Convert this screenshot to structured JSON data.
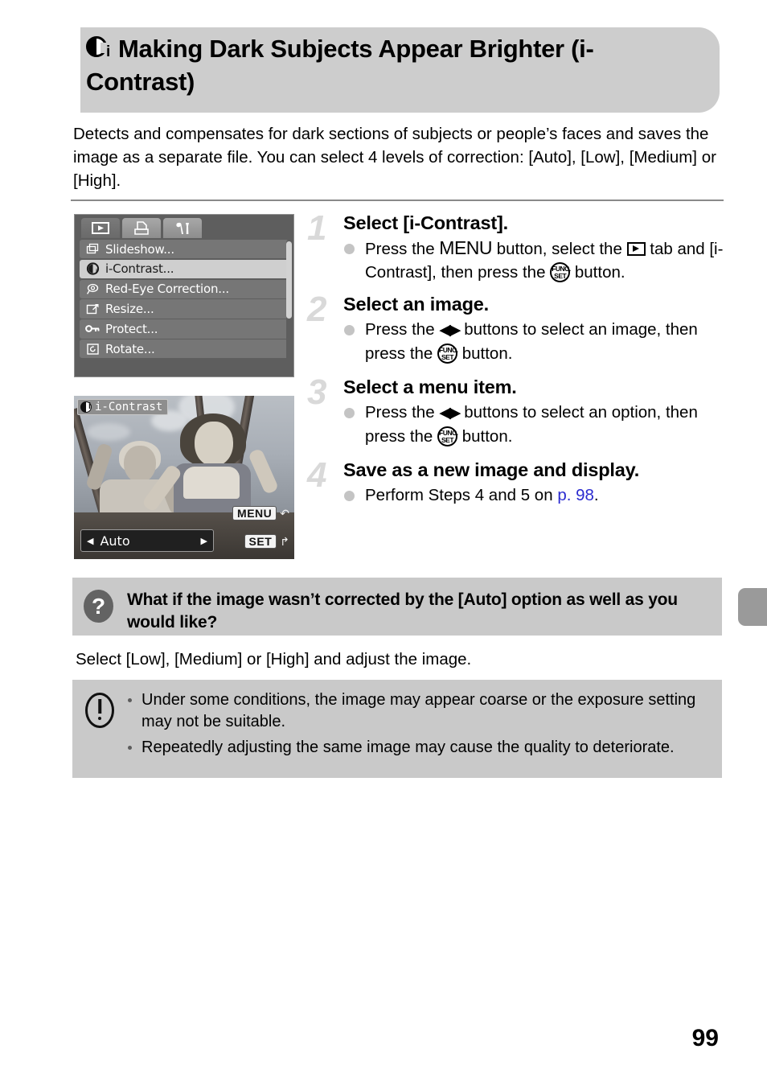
{
  "header": {
    "icon": "i-contrast-icon",
    "title": "Making Dark Subjects Appear Brighter (i-Contrast)",
    "band_color": "#cdcdcd"
  },
  "intro": {
    "text": "Detects and compensates for dark sections of subjects or people’s faces and saves the image as a separate file. You can select 4 levels of correction: [Auto], [Low], [Medium] or [High]."
  },
  "camera_menu_screen": {
    "tabs": [
      {
        "name": "playback-tab",
        "icon": "playback-icon",
        "active": true
      },
      {
        "name": "print-tab",
        "icon": "print-icon",
        "active": false
      },
      {
        "name": "settings-tab",
        "icon": "wrench-hammer-icon",
        "active": false
      }
    ],
    "items": [
      {
        "icon": "slideshow-icon",
        "label": "Slideshow...",
        "selected": false
      },
      {
        "icon": "i-contrast-icon",
        "label": "i-Contrast...",
        "selected": true
      },
      {
        "icon": "red-eye-icon",
        "label": "Red-Eye Correction...",
        "selected": false
      },
      {
        "icon": "resize-icon",
        "label": "Resize...",
        "selected": false
      },
      {
        "icon": "key-icon",
        "label": "Protect...",
        "selected": false
      },
      {
        "icon": "rotate-icon",
        "label": "Rotate...",
        "selected": false
      }
    ]
  },
  "camera_photo_screen": {
    "badge_icon": "i-contrast-icon",
    "badge_label": "i-Contrast",
    "option_value": "Auto",
    "left_arrow": "◀",
    "right_arrow": "▶",
    "hints": [
      {
        "key": "MENU",
        "glyph": "↶",
        "name": "menu-hint"
      },
      {
        "key": "SET",
        "glyph": "↱",
        "name": "set-hint"
      }
    ]
  },
  "steps": [
    {
      "number": "1",
      "title": "Select [i-Contrast].",
      "body_parts": [
        {
          "t": "text",
          "v": "Press the "
        },
        {
          "t": "menu",
          "v": "MENU"
        },
        {
          "t": "text",
          "v": " button, select the "
        },
        {
          "t": "icon",
          "v": "playback-icon"
        },
        {
          "t": "text",
          "v": " tab and [i-Contrast], then press the "
        },
        {
          "t": "icon",
          "v": "func-set-icon"
        },
        {
          "t": "text",
          "v": " button."
        }
      ]
    },
    {
      "number": "2",
      "title": "Select an image.",
      "body_parts": [
        {
          "t": "text",
          "v": "Press the "
        },
        {
          "t": "icon",
          "v": "left-right-arrows-icon"
        },
        {
          "t": "text",
          "v": " buttons to select an image, then press the "
        },
        {
          "t": "icon",
          "v": "func-set-icon"
        },
        {
          "t": "text",
          "v": " button."
        }
      ]
    },
    {
      "number": "3",
      "title": "Select a menu item.",
      "body_parts": [
        {
          "t": "text",
          "v": "Press the "
        },
        {
          "t": "icon",
          "v": "left-right-arrows-icon"
        },
        {
          "t": "text",
          "v": " buttons to select an option, then press the "
        },
        {
          "t": "icon",
          "v": "func-set-icon"
        },
        {
          "t": "text",
          "v": " button."
        }
      ]
    },
    {
      "number": "4",
      "title": "Save as a new image and display.",
      "body_parts": [
        {
          "t": "text",
          "v": "Perform Steps 4 and 5 on "
        },
        {
          "t": "link",
          "v": "p. 98"
        },
        {
          "t": "text",
          "v": "."
        }
      ]
    }
  ],
  "step_text": {
    "s1_title": "Select [i-Contrast].",
    "s1_pre": "Press the ",
    "s1_menu": "MENU",
    "s1_mid": " button, select the ",
    "s1_mid2": " tab and [i-Contrast], then press the ",
    "s1_end": " button.",
    "s2_title": "Select an image.",
    "s2_pre": "Press the ",
    "s2_mid": " buttons to select an image, then press the ",
    "s2_end": " button.",
    "s3_title": "Select a menu item.",
    "s3_pre": "Press the ",
    "s3_mid": " buttons to select an option, then press the ",
    "s3_end": " button.",
    "s4_title": "Save as a new image and display.",
    "s4_pre": "Perform Steps 4 and 5 on ",
    "s4_link": "p. 98",
    "s4_end": "."
  },
  "question_box": {
    "icon": "question-mark-icon",
    "icon_glyph": "?",
    "title": "What if the image wasn’t corrected by the [Auto] option as well as you would like?",
    "answer": "Select [Low], [Medium] or [High] and adjust the image.",
    "bg_color": "#c9c9c9"
  },
  "caution_box": {
    "icon": "exclamation-icon",
    "bg_color": "#c9c9c9",
    "bullets": [
      "Under some conditions, the image may appear coarse or the exposure setting may not be suitable.",
      "Repeatedly adjusting the same image may cause the quality to deteriorate."
    ]
  },
  "page_number": "99",
  "side_tab": {
    "name": "chapter-tab-marker",
    "color": "#9a9a9a"
  },
  "link_color": "#2a2ad0"
}
